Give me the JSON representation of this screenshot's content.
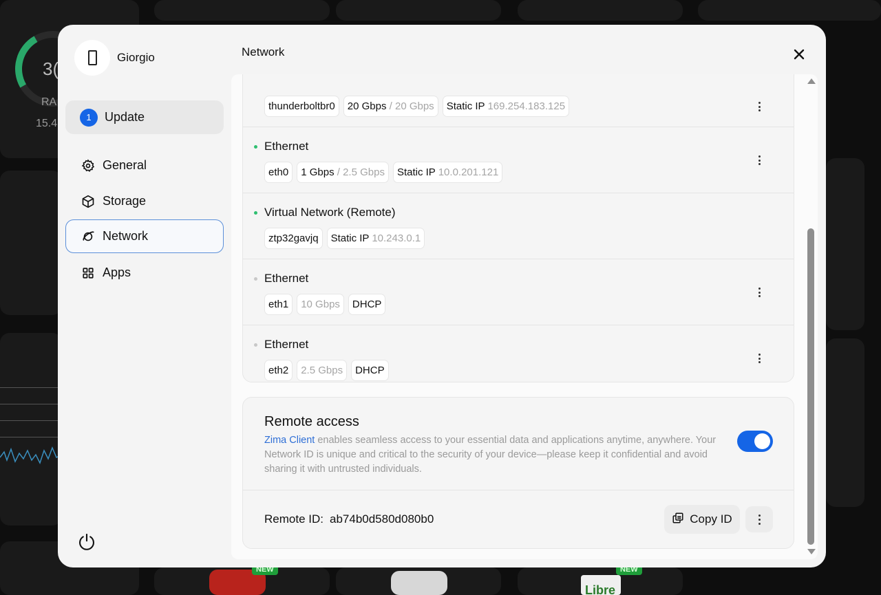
{
  "background": {
    "gauge_value": "3(",
    "gauge_label": "RA",
    "gauge_sub": "15.4",
    "badges": [
      "NEW",
      "NEW"
    ],
    "app_label": "Libre"
  },
  "sidebar": {
    "user_name": "Giorgio",
    "update": {
      "count": "1",
      "label": "Update"
    },
    "items": [
      {
        "label": "General",
        "icon": "gear-icon"
      },
      {
        "label": "Storage",
        "icon": "cube-icon"
      },
      {
        "label": "Network",
        "icon": "planet-icon",
        "active": true
      },
      {
        "label": "Apps",
        "icon": "grid-icon"
      }
    ]
  },
  "header": {
    "title": "Network"
  },
  "networks": [
    {
      "name": "",
      "status": "connected",
      "chips": [
        {
          "label": "thunderboltbr0"
        },
        {
          "label": "20 Gbps",
          "muted": " / 20 Gbps"
        },
        {
          "label": "Static IP",
          "muted": " 169.254.183.125"
        }
      ],
      "has_menu": true
    },
    {
      "name": "Ethernet",
      "status": "connected",
      "chips": [
        {
          "label": "eth0"
        },
        {
          "label": "1 Gbps",
          "muted": " / 2.5 Gbps"
        },
        {
          "label": "Static IP",
          "muted": " 10.0.201.121"
        }
      ],
      "has_menu": true
    },
    {
      "name": "Virtual Network (Remote)",
      "status": "connected",
      "chips": [
        {
          "label": "ztp32gavjq"
        },
        {
          "label": "Static IP",
          "muted": " 10.243.0.1"
        }
      ],
      "has_menu": false
    },
    {
      "name": "Ethernet",
      "status": "disconnected",
      "chips": [
        {
          "label": "eth1"
        },
        {
          "label": "",
          "muted": "10 Gbps"
        },
        {
          "label": "DHCP"
        }
      ],
      "has_menu": true
    },
    {
      "name": "Ethernet",
      "status": "disconnected",
      "chips": [
        {
          "label": "eth2"
        },
        {
          "label": "",
          "muted": "2.5 Gbps"
        },
        {
          "label": "DHCP"
        }
      ],
      "has_menu": true
    }
  ],
  "remote_access": {
    "title": "Remote access",
    "link_text": "Zima Client",
    "description": " enables seamless access to your essential data and applications anytime, anywhere. Your Network ID is unique and critical to the security of your device—please keep it confidential and avoid sharing it with untrusted individuals.",
    "enabled": true,
    "id_label": "Remote ID:",
    "id_value": "ab74b0d580d080b0",
    "copy_label": "Copy ID"
  },
  "colors": {
    "accent": "#1565e6",
    "connected_dot": "#2fbf71",
    "disconnected_dot": "#c8c8c8",
    "link": "#2f6fd6"
  }
}
